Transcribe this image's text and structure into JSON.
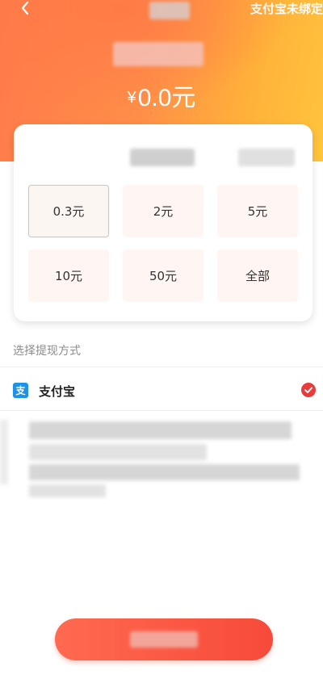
{
  "header": {
    "unbound_notice": "支付宝未绑定",
    "balance_symbol": "¥",
    "balance_amount": "0.0元"
  },
  "amount_options": [
    {
      "label": "0.3元",
      "selected": true
    },
    {
      "label": "2元",
      "selected": false
    },
    {
      "label": "5元",
      "selected": false
    },
    {
      "label": "10元",
      "selected": false
    },
    {
      "label": "50元",
      "selected": false
    },
    {
      "label": "全部",
      "selected": false
    }
  ],
  "withdraw_method": {
    "section_label": "选择提现方式",
    "alipay_label": "支付宝",
    "alipay_icon_glyph": "支",
    "selected": true
  },
  "colors": {
    "accent": "#f74a3a",
    "header_start": "#ff7a4a",
    "header_end": "#ffc43c",
    "alipay_blue": "#1e92e6"
  },
  "icons": {
    "back": "chevron-left-icon",
    "alipay": "alipay-icon",
    "check": "check-circle-icon"
  }
}
